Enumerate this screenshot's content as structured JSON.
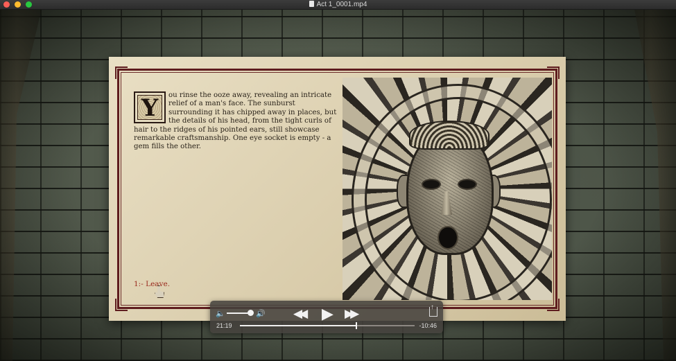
{
  "window": {
    "title": "Act 1_0001.mp4",
    "file_icon": "document-icon"
  },
  "story": {
    "drop_cap": "Y",
    "text": "ou rinse the ooze away, revealing an intricate relief of a man's face. The sunburst surrounding it has chipped away in places, but the details of his head, from the tight curls of hair to the ridges of his pointed ears, still showcase remarkable craftsmanship. One eye socket is empty - a gem fills the other."
  },
  "choices": [
    {
      "label": "1:- Leave."
    }
  ],
  "player": {
    "current_time": "21:19",
    "remaining_time": "-10:46",
    "progress": 0.665,
    "volume": 0.85,
    "icons": {
      "volume_low": "speaker-low-icon",
      "volume_high": "speaker-high-icon",
      "rewind": "rewind-icon",
      "play": "play-icon",
      "fast_forward": "fast-forward-icon",
      "share": "share-icon"
    }
  },
  "colors": {
    "frame": "#5e1c1e",
    "choice_text": "#9a2a1e",
    "hud_bg": "#46423e"
  }
}
